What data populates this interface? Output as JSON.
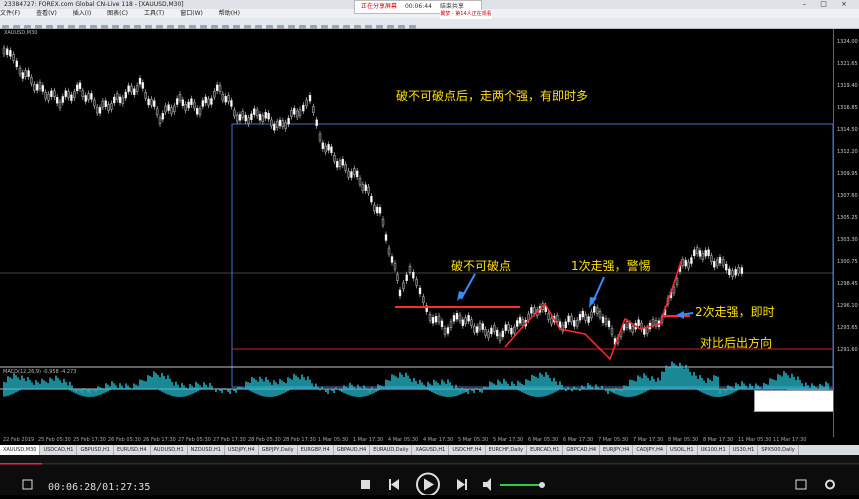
{
  "window": {
    "title": "23384727: FOREX.com Global CN-Live 118 - [XAUUSD,M30]",
    "controls": "– □ ×"
  },
  "menu": [
    "文件(F)",
    "查看(V)",
    "插入(I)",
    "图表(C)",
    "工具(T)",
    "窗口(W)",
    "帮助(H)"
  ],
  "recorder": {
    "status": "正在分享屏幕",
    "time": "00:06:44",
    "stop": "结束共享"
  },
  "recorder_note": "翼梦 - 第14人正在观看",
  "chart": {
    "symbol": "XAUUSD,M30",
    "annotations": {
      "main": "破不可破点后，走两个强，有即时多",
      "point": "破不可破点",
      "strong1": "1次走强，警惕",
      "strong2": "2次走强，即时",
      "compare": "对比后出方向"
    },
    "macd_label": "MACD(12,26,9) -0.958 -4.273",
    "price_labels": [
      "1324.00",
      "1321.65",
      "1319.40",
      "1316.85",
      "1314.50",
      "1312.20",
      "1309.95",
      "1307.60",
      "1305.25",
      "1303.30",
      "1300.75",
      "1298.45",
      "1296.10",
      "1293.65",
      "1291.60"
    ],
    "time_labels": [
      "22 Feb 2019",
      "25 Feb 05:30",
      "25 Feb 17:30",
      "26 Feb 05:30",
      "26 Feb 17:30",
      "27 Feb 05:30",
      "27 Feb 17:30",
      "28 Feb 05:30",
      "28 Feb 17:30",
      "1 Mar 05:30",
      "1 Mar 17:30",
      "4 Mar 05:30",
      "4 Mar 17:30",
      "5 Mar 05:30",
      "5 Mar 17:30",
      "6 Mar 05:30",
      "6 Mar 17:30",
      "7 Mar 05:30",
      "7 Mar 17:30",
      "8 Mar 05:30",
      "8 Mar 17:30",
      "11 Mar 05:30",
      "11 Mar 17:30"
    ]
  },
  "tabs": [
    "XAUUSD,M30",
    "USDCAD,H1",
    "GBPUSD,H1",
    "EURUSD,H4",
    "AUDUSD,H1",
    "NZDUSD,H1",
    "USDJPY,H4",
    "GBPJPY,Daily",
    "EURGBP,H4",
    "GBPAUD,H4",
    "EURAUD,Daily",
    "XAGUSD,H1",
    "USDCHF,H4",
    "EURCHF,Daily",
    "EURCAD,H1",
    "GBPCAD,H4",
    "EURJPY,H4",
    "CADJPY,H4",
    "USOIL,H1",
    "UK100,H1",
    "US30,H1",
    "SPX500,Daily"
  ],
  "player": {
    "time": "00:06:28/01:27:35"
  }
}
